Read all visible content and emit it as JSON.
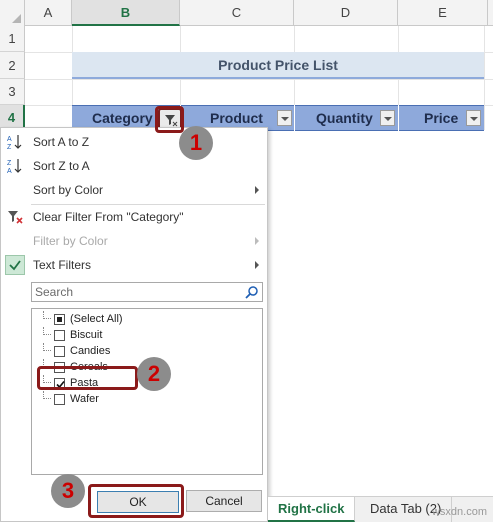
{
  "sheet": {
    "corner_label": "",
    "columns": [
      {
        "label": "A"
      },
      {
        "label": "B"
      },
      {
        "label": "C"
      },
      {
        "label": "D"
      },
      {
        "label": "E"
      }
    ],
    "rows": [
      {
        "label": "1"
      },
      {
        "label": "2"
      },
      {
        "label": "3"
      },
      {
        "label": "4"
      }
    ],
    "title": "Product Price List",
    "headers": [
      "Category",
      "Product",
      "Quantity",
      "Price"
    ]
  },
  "filter_menu": {
    "items": [
      {
        "label": "Sort A to Z",
        "icon": "sort-ascending-icon",
        "enabled": true,
        "submenu": false
      },
      {
        "label": "Sort Z to A",
        "icon": "sort-descending-icon",
        "enabled": true,
        "submenu": false
      },
      {
        "label": "Sort by Color",
        "enabled": true,
        "submenu": true
      },
      {
        "label": "Clear Filter From \"Category\"",
        "icon": "clear-filter-icon",
        "enabled": true,
        "submenu": false
      },
      {
        "label": "Filter by Color",
        "enabled": false,
        "submenu": true
      },
      {
        "label": "Text Filters",
        "icon": "check-icon",
        "enabled": true,
        "submenu": true
      }
    ],
    "search_placeholder": "Search",
    "list": [
      {
        "label": "(Select All)",
        "state": "partial"
      },
      {
        "label": "Biscuit",
        "state": "unchecked"
      },
      {
        "label": "Candies",
        "state": "unchecked"
      },
      {
        "label": "Cereals",
        "state": "unchecked"
      },
      {
        "label": "Pasta",
        "state": "checked"
      },
      {
        "label": "Wafer",
        "state": "unchecked"
      }
    ],
    "ok_label": "OK",
    "cancel_label": "Cancel"
  },
  "callouts": [
    "1",
    "2",
    "3"
  ],
  "tabs": [
    {
      "label": "Right-click",
      "active": true
    },
    {
      "label": "Data Tab (2)",
      "active": false
    }
  ],
  "watermark": "wsxdn.com",
  "colors": {
    "accent": "#217346",
    "header_band": "#8ea9db",
    "title_band": "#dce6f1",
    "highlight": "#8b1a1a",
    "badge_text": "#cc0000"
  }
}
